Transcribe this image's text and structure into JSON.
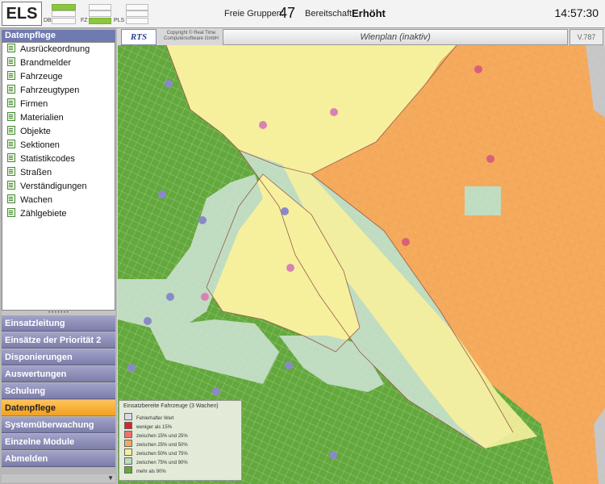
{
  "header": {
    "app_name": "ELS",
    "indicators": [
      "DB",
      "FZ",
      "PLS"
    ],
    "freie_gruppen_label": "Freie Gruppen:",
    "freie_gruppen_value": "47",
    "bereitschaft_label": "Bereitschaft:",
    "bereitschaft_value": "Erhöht",
    "clock": "14:57:30"
  },
  "sidebar": {
    "section_title": "Datenpflege",
    "items": [
      "Ausrückeordnung",
      "Brandmelder",
      "Fahrzeuge",
      "Fahrzeugtypen",
      "Firmen",
      "Materialien",
      "Objekte",
      "Sektionen",
      "Statistikcodes",
      "Straßen",
      "Verständigungen",
      "Wachen",
      "Zählgebiete"
    ],
    "menu": [
      "Einsatzleitung",
      "Einsätze der Priorität 2",
      "Disponierungen",
      "Auswertungen",
      "Schulung",
      "Datenpflege",
      "Systemüberwachung",
      "Einzelne Module",
      "Abmelden"
    ],
    "active_menu": "Datenpflege"
  },
  "map": {
    "logo_text": "RTS",
    "copyright_line1": "Copyright © Real Time",
    "copyright_line2": "Computersoftware GmbH",
    "title": "Wienplan (inaktiv)",
    "version": "V.787",
    "legend_title": "Einsatzbereite Fahrzeuge (3 Wachen)",
    "legend": [
      {
        "label": "Fehlerhafter Wert",
        "color": "#d9d9e8"
      },
      {
        "label": "weniger als 15%",
        "color": "#d9262b"
      },
      {
        "label": "zwischen 15% und 25%",
        "color": "#f07070"
      },
      {
        "label": "zwischen 25% und 50%",
        "color": "#f5a95a"
      },
      {
        "label": "zwischen 50% und 75%",
        "color": "#f6f09c"
      },
      {
        "label": "zwischen 75% und 90%",
        "color": "#bfdcc0"
      },
      {
        "label": "mehr als 90%",
        "color": "#63a83c"
      }
    ]
  }
}
